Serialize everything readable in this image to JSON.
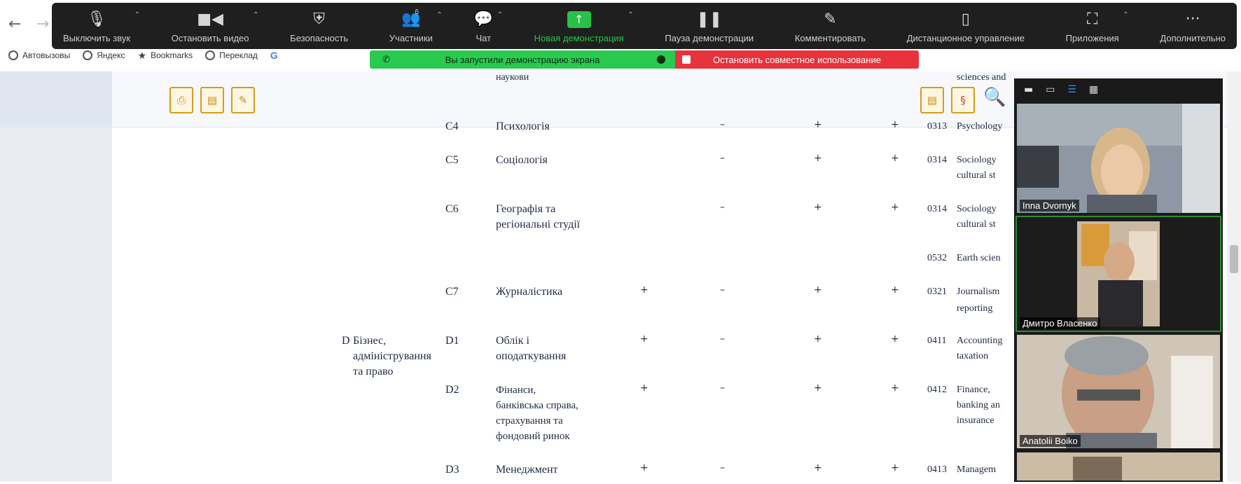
{
  "browser": {
    "back": "←",
    "forward": "→",
    "bookmarks": [
      {
        "label": "Автовызовы",
        "icon": "globe-icon"
      },
      {
        "label": "Яндекс",
        "icon": "globe-icon"
      },
      {
        "label": "Bookmarks",
        "icon": "star-icon"
      },
      {
        "label": "Переклад",
        "icon": "globe-icon"
      },
      {
        "label": "G",
        "icon": "google-icon"
      }
    ]
  },
  "zoom_toolbar": {
    "items": [
      {
        "label": "Выключить звук",
        "icon": "mic-icon"
      },
      {
        "label": "Остановить видео",
        "icon": "video-camera-icon"
      },
      {
        "label": "Безопасность",
        "icon": "shield-icon"
      },
      {
        "label": "Участники",
        "icon": "participants-icon",
        "count": "6"
      },
      {
        "label": "Чат",
        "icon": "chat-icon"
      },
      {
        "label": "Новая демонстрация",
        "icon": "share-screen-icon"
      },
      {
        "label": "Пауза демонстрации",
        "icon": "pause-icon"
      },
      {
        "label": "Комментировать",
        "icon": "pencil-icon"
      },
      {
        "label": "Дистанционное управление",
        "icon": "mouse-icon"
      },
      {
        "label": "Приложения",
        "icon": "apps-icon"
      },
      {
        "label": "Дополнительно",
        "icon": "more-icon"
      }
    ]
  },
  "share_banner": {
    "green_text": "Вы запустили демонстрацию экрана",
    "red_text": "Остановить совместное использование"
  },
  "document": {
    "top_text_left": "наукови",
    "top_text_right": "sciences and",
    "rows": [
      {
        "code": "C4",
        "name": "Психологія",
        "marks": [
          "–",
          "+",
          "+"
        ],
        "iscd": "0313",
        "en": "Psychology"
      },
      {
        "code": "C5",
        "name": "Соціологія",
        "marks": [
          "–",
          "+",
          "+"
        ],
        "iscd": "0314",
        "en": "Sociology",
        "en2": "cultural st"
      },
      {
        "code": "C6",
        "name": "Географія та",
        "name2": "регіональні студії",
        "marks": [
          "–",
          "+",
          "+"
        ],
        "iscd": "0314",
        "en": "Sociology",
        "en2": "cultural st"
      },
      {
        "iscd": "0532",
        "en": "Earth scien"
      },
      {
        "code": "C7",
        "name": "Журналістика",
        "marks4": [
          "+",
          "–",
          "+",
          "+"
        ],
        "iscd": "0321",
        "en": "Journalism",
        "en2": "reporting"
      },
      {
        "code": "D1",
        "name": "Облік і",
        "name2": "оподаткування",
        "marks4": [
          "+",
          "–",
          "+",
          "+"
        ],
        "iscd": "0411",
        "en": "Accounting",
        "en2": "taxation"
      },
      {
        "code": "D2",
        "name": "Фінанси,",
        "name2": "банківська справа,",
        "name3": "страхування та",
        "name4": "фондовий ринок",
        "marks4": [
          "+",
          "–",
          "+",
          "+"
        ],
        "iscd": "0412",
        "en": "Finance,",
        "en2": "banking an",
        "en3": "insurance"
      },
      {
        "code": "D3",
        "name": "Менеджмент",
        "marks4": [
          "+",
          "–",
          "+",
          "+"
        ],
        "iscd": "0413",
        "en": "Managem"
      }
    ],
    "section_d": {
      "letter": "D",
      "line1": "Бізнес,",
      "line2": "адміністрування",
      "line3": "та право"
    }
  },
  "video_panel": {
    "view_icons": [
      "minimize-icon",
      "speaker-view-icon",
      "strip-view-icon",
      "gallery-view-icon"
    ],
    "tiles": [
      {
        "name": "Inna Dvornyk"
      },
      {
        "name": "Дмитро Власенко"
      },
      {
        "name": "Anatolii Boiko"
      }
    ]
  }
}
